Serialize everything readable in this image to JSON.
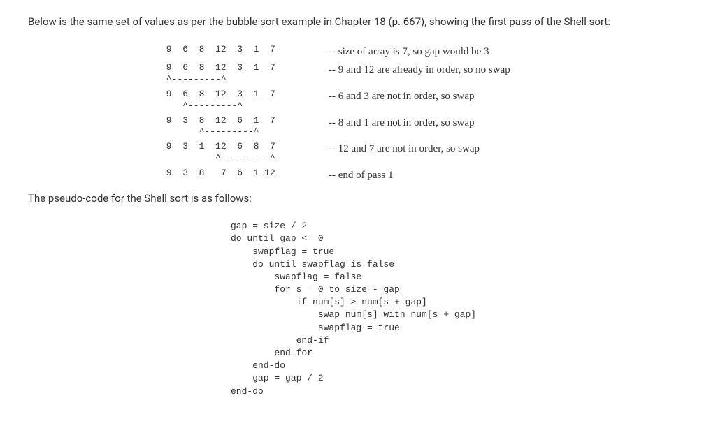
{
  "intro": "Below is the same set of values as per the bubble sort example in Chapter 18 (p. 667), showing the first pass of the Shell sort:",
  "trace": [
    {
      "values": " 9  6  8  12  3  1  7",
      "pointers": "",
      "comment": "-- size of array is 7, so gap would be 3"
    },
    {
      "values": " 9  6  8  12  3  1  7",
      "pointers": " ^---------^",
      "comment": "-- 9 and 12 are already in order, so no swap"
    },
    {
      "values": " 9  6  8  12  3  1  7",
      "pointers": "    ^---------^",
      "comment": "-- 6 and 3 are not in order, so swap"
    },
    {
      "values": " 9  3  8  12  6  1  7",
      "pointers": "       ^---------^",
      "comment": "-- 8 and 1 are not in order, so swap"
    },
    {
      "values": " 9  3  1  12  6  8  7",
      "pointers": "          ^---------^",
      "comment": "-- 12 and 7 are not in order, so swap"
    },
    {
      "values": " 9  3  8   7  6  1 12",
      "pointers": "",
      "comment": "-- end of pass 1"
    }
  ],
  "mid": "The pseudo-code for the Shell sort is as follows:",
  "pseudo": "gap = size / 2\ndo until gap <= 0\n    swapflag = true\n    do until swapflag is false\n        swapflag = false\n        for s = 0 to size - gap\n            if num[s] > num[s + gap]\n                swap num[s] with num[s + gap]\n                swapflag = true\n            end-if\n        end-for\n    end-do\n    gap = gap / 2\nend-do"
}
